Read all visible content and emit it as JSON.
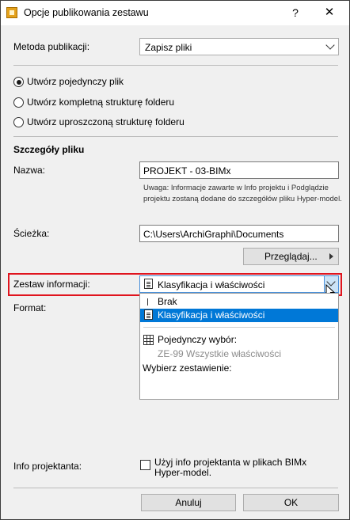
{
  "window": {
    "title": "Opcje publikowania zestawu",
    "help": "?",
    "close": "✕"
  },
  "method": {
    "label": "Metoda publikacji:",
    "value": "Zapisz pliki"
  },
  "radios": [
    {
      "label": "Utwórz pojedynczy plik",
      "checked": true
    },
    {
      "label": "Utwórz kompletną strukturę folderu",
      "checked": false
    },
    {
      "label": "Utwórz uproszczoną strukturę folderu",
      "checked": false
    }
  ],
  "details": {
    "heading": "Szczegóły pliku",
    "name_label": "Nazwa:",
    "name_value": "PROJEKT - 03-BIMx",
    "note_line1": "Uwaga: Informacje zawarte w Info projektu i Podglądzie",
    "note_line2": "projektu zostaną dodane do szczegółów pliku Hyper-model.",
    "path_label": "Ścieżka:",
    "path_value": "C:\\Users\\ArchiGraphi\\Documents",
    "browse_label": "Przeglądaj..."
  },
  "info_set": {
    "label": "Zestaw informacji:",
    "value": "Klasyfikacja i właściwości",
    "options": {
      "none": "Brak",
      "selected": "Klasyfikacja i właściwości",
      "single_choice": "Pojedynczy wybór:",
      "all_properties": "ZE-99 Wszystkie właściwości",
      "choose_set": "Wybierz zestawienie:"
    }
  },
  "format": {
    "label": "Format:"
  },
  "designer": {
    "label": "Info projektanta:",
    "checkbox_line1": "Użyj info projektanta w plikach BIMx",
    "checkbox_line2": "Hyper-model.",
    "checked": false
  },
  "buttons": {
    "cancel": "Anuluj",
    "ok": "OK"
  },
  "colors": {
    "highlight": "#e0141e",
    "selection": "#0078d7",
    "background": "#f0f0f0"
  }
}
